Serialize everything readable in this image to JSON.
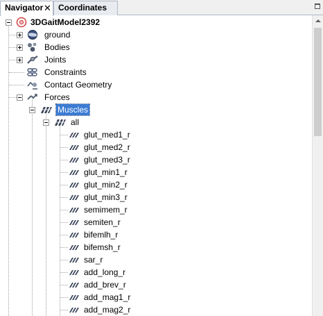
{
  "tabs": [
    {
      "label": "Navigator",
      "close": "✕",
      "active": true
    },
    {
      "label": "Coordinates",
      "active": false
    }
  ],
  "tree": {
    "root": {
      "label": "3DGaitModel2392",
      "icon": "model-icon"
    },
    "top_items": [
      {
        "label": "ground",
        "icon": "ground-icon",
        "expander": "+"
      },
      {
        "label": "Bodies",
        "icon": "bodies-icon",
        "expander": "+"
      },
      {
        "label": "Joints",
        "icon": "joints-icon",
        "expander": "+"
      },
      {
        "label": "Constraints",
        "icon": "constraints-icon",
        "expander": ""
      },
      {
        "label": "Contact Geometry",
        "icon": "contact-geometry-icon",
        "expander": ""
      },
      {
        "label": "Forces",
        "icon": "forces-icon",
        "expander": "-"
      }
    ],
    "muscles": {
      "label": "Muscles",
      "icon": "muscle-group-icon",
      "selected": true
    },
    "all": {
      "label": "all",
      "icon": "muscle-group-icon"
    },
    "muscle_items": [
      "glut_med1_r",
      "glut_med2_r",
      "glut_med3_r",
      "glut_min1_r",
      "glut_min2_r",
      "glut_min3_r",
      "semimem_r",
      "semiten_r",
      "bifemlh_r",
      "bifemsh_r",
      "sar_r",
      "add_long_r",
      "add_brev_r",
      "add_mag1_r",
      "add_mag2_r"
    ]
  },
  "colors": {
    "selection": "#3b7bd3",
    "tab_border": "#aeb8c6"
  }
}
